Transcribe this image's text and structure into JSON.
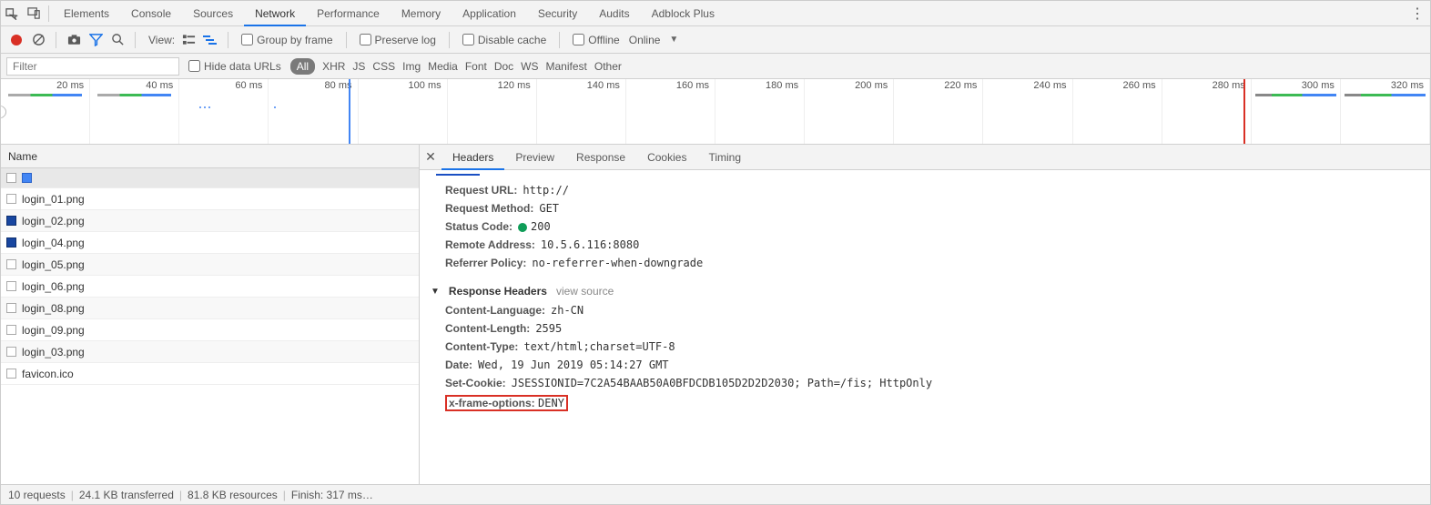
{
  "tabs": {
    "elements": "Elements",
    "console": "Console",
    "sources": "Sources",
    "network": "Network",
    "performance": "Performance",
    "memory": "Memory",
    "application": "Application",
    "security": "Security",
    "audits": "Audits",
    "adblock": "Adblock Plus"
  },
  "toolbar": {
    "view_label": "View:",
    "group_by_frame": "Group by frame",
    "preserve_log": "Preserve log",
    "disable_cache": "Disable cache",
    "offline": "Offline",
    "throttle_selected": "Online"
  },
  "filter": {
    "placeholder": "Filter",
    "hide_data_urls": "Hide data URLs",
    "types": {
      "all": "All",
      "xhr": "XHR",
      "js": "JS",
      "css": "CSS",
      "img": "Img",
      "media": "Media",
      "font": "Font",
      "doc": "Doc",
      "ws": "WS",
      "manifest": "Manifest",
      "other": "Other"
    }
  },
  "timeline": {
    "ticks": [
      "20 ms",
      "40 ms",
      "60 ms",
      "80 ms",
      "100 ms",
      "120 ms",
      "140 ms",
      "160 ms",
      "180 ms",
      "200 ms",
      "220 ms",
      "240 ms",
      "260 ms",
      "280 ms",
      "300 ms",
      "320 ms"
    ]
  },
  "name_header": "Name",
  "requests": [
    {
      "name": "login_01.png",
      "icon": "outline"
    },
    {
      "name": "login_02.png",
      "icon": "blue"
    },
    {
      "name": "login_04.png",
      "icon": "blue"
    },
    {
      "name": "login_05.png",
      "icon": "outline"
    },
    {
      "name": "login_06.png",
      "icon": "outline"
    },
    {
      "name": "login_08.png",
      "icon": "outline"
    },
    {
      "name": "login_09.png",
      "icon": "outline"
    },
    {
      "name": "login_03.png",
      "icon": "outline"
    },
    {
      "name": "favicon.ico",
      "icon": "outline"
    }
  ],
  "detail_tabs": {
    "headers": "Headers",
    "preview": "Preview",
    "response": "Response",
    "cookies": "Cookies",
    "timing": "Timing"
  },
  "general": {
    "request_url": {
      "k": "Request URL:",
      "v": "http://"
    },
    "request_method": {
      "k": "Request Method:",
      "v": "GET"
    },
    "status_code": {
      "k": "Status Code:",
      "v": "200"
    },
    "remote_address": {
      "k": "Remote Address:",
      "v": "10.5.6.116:8080"
    },
    "referrer_policy": {
      "k": "Referrer Policy:",
      "v": "no-referrer-when-downgrade"
    }
  },
  "response_headers": {
    "title": "Response Headers",
    "view_source": "view source",
    "content_language": {
      "k": "Content-Language:",
      "v": "zh-CN"
    },
    "content_length": {
      "k": "Content-Length:",
      "v": "2595"
    },
    "content_type": {
      "k": "Content-Type:",
      "v": "text/html;charset=UTF-8"
    },
    "date": {
      "k": "Date:",
      "v": "Wed, 19 Jun 2019 05:14:27 GMT"
    },
    "set_cookie": {
      "k": "Set-Cookie:",
      "v": "JSESSIONID=7C2A54BAAB50A0BFDCDB105D2D2D2030; Path=/fis; HttpOnly"
    },
    "x_frame_options": {
      "k": "x-frame-options:",
      "v": "DENY"
    }
  },
  "status": {
    "requests": "10 requests",
    "transferred": "24.1 KB transferred",
    "resources": "81.8 KB resources",
    "finish": "Finish: 317 ms…"
  }
}
